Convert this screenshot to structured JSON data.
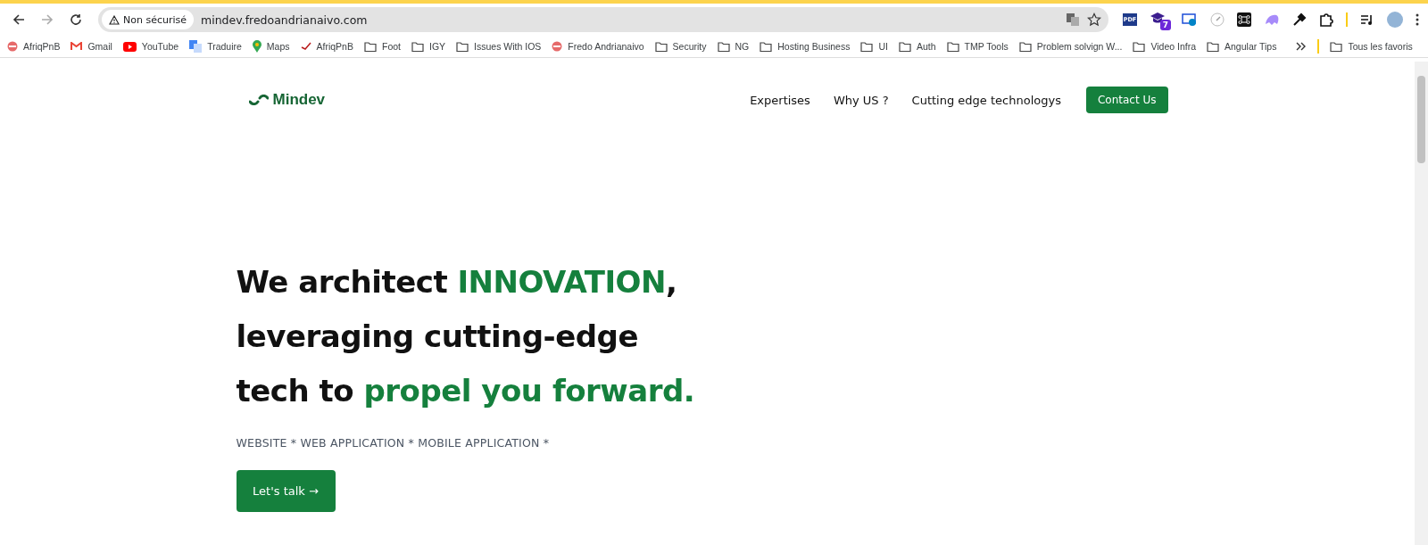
{
  "browser": {
    "security_label": "Non sécurisé",
    "url": "mindev.fredoandrianaivo.com",
    "extensions": [
      {
        "kind": "pdf",
        "text": "PDF"
      },
      {
        "kind": "badge",
        "text": "7"
      },
      {
        "kind": "camera"
      },
      {
        "kind": "compass"
      },
      {
        "kind": "command"
      },
      {
        "kind": "ghost"
      },
      {
        "kind": "dropper"
      },
      {
        "kind": "puzzle"
      }
    ]
  },
  "bookmarks": [
    {
      "kind": "site",
      "label": "AfriqPnB"
    },
    {
      "kind": "gmail",
      "label": "Gmail"
    },
    {
      "kind": "youtube",
      "label": "YouTube"
    },
    {
      "kind": "translate",
      "label": "Traduire"
    },
    {
      "kind": "maps",
      "label": "Maps"
    },
    {
      "kind": "mark",
      "label": "AfriqPnB"
    },
    {
      "kind": "folder",
      "label": "Foot"
    },
    {
      "kind": "folder",
      "label": "IGY"
    },
    {
      "kind": "folder",
      "label": "Issues With IOS"
    },
    {
      "kind": "site",
      "label": "Fredo Andrianaivo"
    },
    {
      "kind": "folder",
      "label": "Security"
    },
    {
      "kind": "folder",
      "label": "NG"
    },
    {
      "kind": "folder",
      "label": "Hosting Business"
    },
    {
      "kind": "folder",
      "label": "UI"
    },
    {
      "kind": "folder",
      "label": "Auth"
    },
    {
      "kind": "folder",
      "label": "TMP Tools"
    },
    {
      "kind": "folder",
      "label": "Problem solvign W..."
    },
    {
      "kind": "folder",
      "label": "Video Infra"
    },
    {
      "kind": "folder",
      "label": "Angular Tips"
    }
  ],
  "all_bookmarks": "Tous les favoris",
  "site": {
    "logo": "Mindev",
    "nav": [
      "Expertises",
      "Why US ?",
      "Cutting edge technologys"
    ],
    "contact_button": "Contact Us",
    "heading": [
      [
        {
          "text": "We architect ",
          "accent": false
        },
        {
          "text": "INNOVATION",
          "accent": true
        },
        {
          "text": ",",
          "accent": false
        }
      ],
      [
        {
          "text": "leveraging cutting-edge",
          "accent": false
        }
      ],
      [
        {
          "text": "tech to ",
          "accent": false
        },
        {
          "text": "propel you forward.",
          "accent": true
        }
      ]
    ],
    "services": "WEBSITE * WEB APPLICATION * MOBILE APPLICATION *",
    "cta_button": "Let's talk →"
  }
}
